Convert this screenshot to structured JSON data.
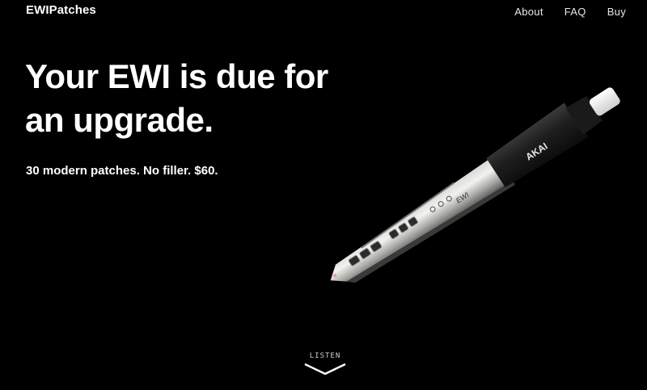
{
  "header": {
    "brand": "EWIPatches",
    "nav": [
      {
        "label": "About"
      },
      {
        "label": "FAQ"
      },
      {
        "label": "Buy"
      }
    ]
  },
  "hero": {
    "headline": "Your EWI is due for an upgrade.",
    "subline": "30 modern patches. No filler. $60.",
    "image": {
      "subject": "Akai EWI electronic wind instrument",
      "brand_mark": "AKAI",
      "model_mark": "EWI"
    }
  },
  "scroll_cue": {
    "label": "LISTEN",
    "icon": "chevron-down-icon"
  },
  "colors": {
    "background": "#000000",
    "text": "#ffffff"
  }
}
